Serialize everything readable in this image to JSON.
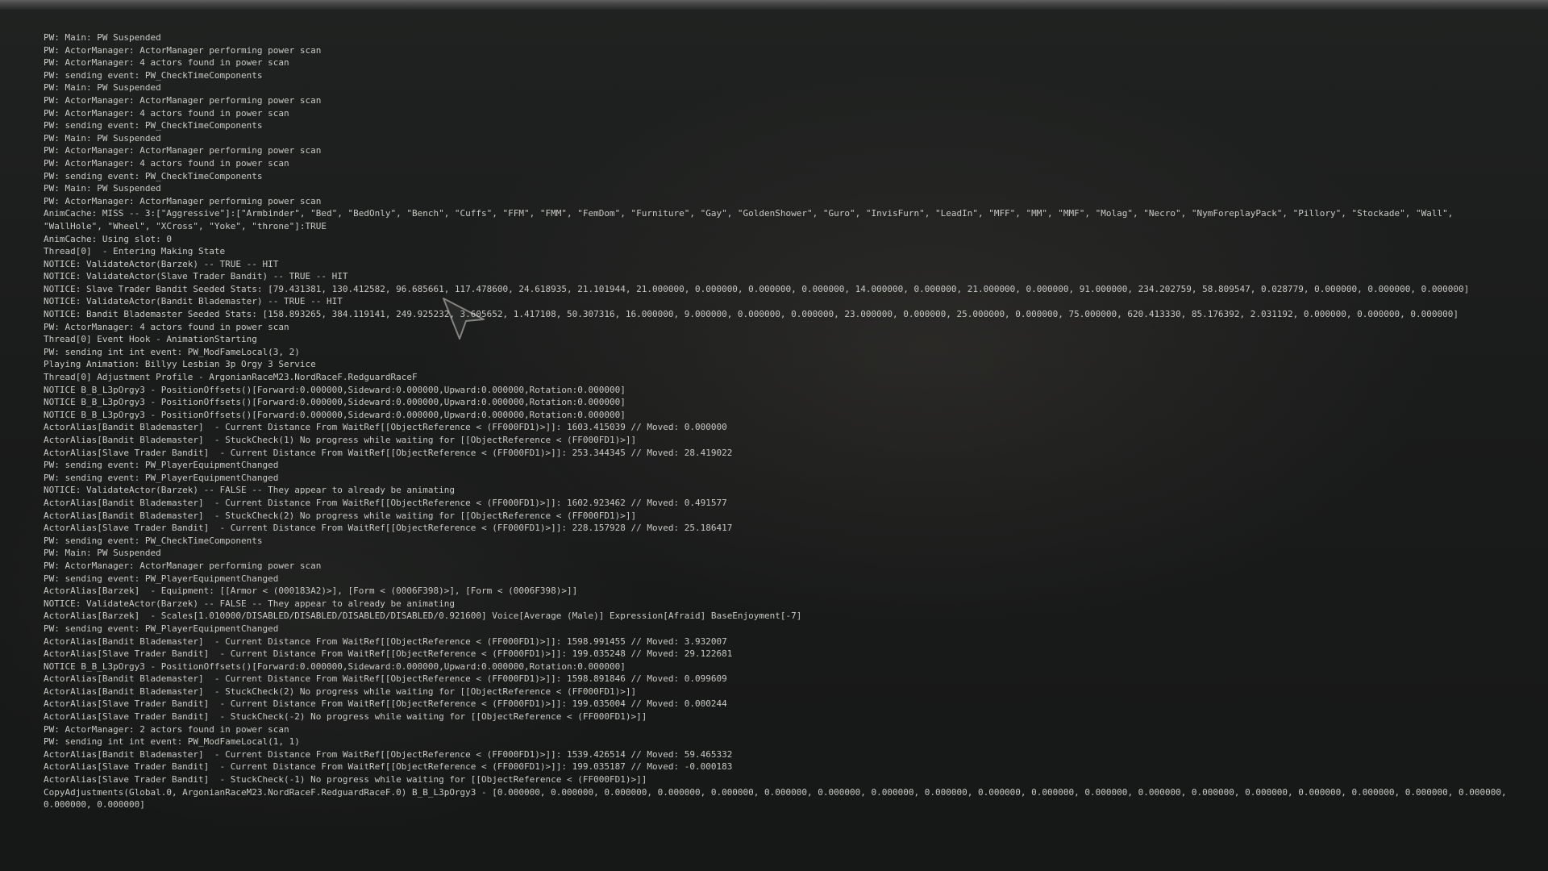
{
  "console": {
    "lines": [
      "PW: Main: PW Suspended",
      "PW: ActorManager: ActorManager performing power scan",
      "PW: ActorManager: 4 actors found in power scan",
      "PW: sending event: PW_CheckTimeComponents",
      "PW: Main: PW Suspended",
      "PW: ActorManager: ActorManager performing power scan",
      "PW: ActorManager: 4 actors found in power scan",
      "PW: sending event: PW_CheckTimeComponents",
      "PW: Main: PW Suspended",
      "PW: ActorManager: ActorManager performing power scan",
      "PW: ActorManager: 4 actors found in power scan",
      "PW: sending event: PW_CheckTimeComponents",
      "PW: Main: PW Suspended",
      "PW: ActorManager: ActorManager performing power scan",
      "AnimCache: MISS -- 3:[\"Aggressive\"]:[\"Armbinder\", \"Bed\", \"BedOnly\", \"Bench\", \"Cuffs\", \"FFM\", \"FMM\", \"FemDom\", \"Furniture\", \"Gay\", \"GoldenShower\", \"Guro\", \"InvisFurn\", \"LeadIn\", \"MFF\", \"MM\", \"MMF\", \"Molag\", \"Necro\", \"NymForeplayPack\", \"Pillory\", \"Stockade\", \"Wall\", \"WallHole\", \"Wheel\", \"XCross\", \"Yoke\", \"throne\"]:TRUE",
      "AnimCache: Using slot: 0",
      "Thread[0]  - Entering Making State",
      "NOTICE: ValidateActor(Barzek) -- TRUE -- HIT",
      "NOTICE: ValidateActor(Slave Trader Bandit) -- TRUE -- HIT",
      "NOTICE: Slave Trader Bandit Seeded Stats: [79.431381, 130.412582, 96.685661, 117.478600, 24.618935, 21.101944, 21.000000, 0.000000, 0.000000, 0.000000, 14.000000, 0.000000, 21.000000, 0.000000, 91.000000, 234.202759, 58.809547, 0.028779, 0.000000, 0.000000, 0.000000]",
      "NOTICE: ValidateActor(Bandit Blademaster) -- TRUE -- HIT",
      "NOTICE: Bandit Blademaster Seeded Stats: [158.893265, 384.119141, 249.925232, 3.605652, 1.417108, 50.307316, 16.000000, 9.000000, 0.000000, 0.000000, 23.000000, 0.000000, 25.000000, 0.000000, 75.000000, 620.413330, 85.176392, 2.031192, 0.000000, 0.000000, 0.000000]",
      "PW: ActorManager: 4 actors found in power scan",
      "Thread[0] Event Hook - AnimationStarting",
      "PW: sending int int event: PW_ModFameLocal(3, 2)",
      "Playing Animation: Billyy Lesbian 3p Orgy 3 Service",
      "Thread[0] Adjustment Profile - ArgonianRaceM23.NordRaceF.RedguardRaceF",
      "NOTICE B_B_L3pOrgy3 - PositionOffsets()[Forward:0.000000,Sideward:0.000000,Upward:0.000000,Rotation:0.000000]",
      "NOTICE B_B_L3pOrgy3 - PositionOffsets()[Forward:0.000000,Sideward:0.000000,Upward:0.000000,Rotation:0.000000]",
      "NOTICE B_B_L3pOrgy3 - PositionOffsets()[Forward:0.000000,Sideward:0.000000,Upward:0.000000,Rotation:0.000000]",
      "ActorAlias[Bandit Blademaster]  - Current Distance From WaitRef[[ObjectReference < (FF000FD1)>]]: 1603.415039 // Moved: 0.000000",
      "ActorAlias[Bandit Blademaster]  - StuckCheck(1) No progress while waiting for [[ObjectReference < (FF000FD1)>]]",
      "ActorAlias[Slave Trader Bandit]  - Current Distance From WaitRef[[ObjectReference < (FF000FD1)>]]: 253.344345 // Moved: 28.419022",
      "PW: sending event: PW_PlayerEquipmentChanged",
      "PW: sending event: PW_PlayerEquipmentChanged",
      "NOTICE: ValidateActor(Barzek) -- FALSE -- They appear to already be animating",
      "ActorAlias[Bandit Blademaster]  - Current Distance From WaitRef[[ObjectReference < (FF000FD1)>]]: 1602.923462 // Moved: 0.491577",
      "ActorAlias[Bandit Blademaster]  - StuckCheck(2) No progress while waiting for [[ObjectReference < (FF000FD1)>]]",
      "ActorAlias[Slave Trader Bandit]  - Current Distance From WaitRef[[ObjectReference < (FF000FD1)>]]: 228.157928 // Moved: 25.186417",
      "PW: sending event: PW_CheckTimeComponents",
      "PW: Main: PW Suspended",
      "PW: ActorManager: ActorManager performing power scan",
      "PW: sending event: PW_PlayerEquipmentChanged",
      "ActorAlias[Barzek]  - Equipment: [[Armor < (000183A2)>], [Form < (0006F398)>], [Form < (0006F398)>]]",
      "NOTICE: ValidateActor(Barzek) -- FALSE -- They appear to already be animating",
      "ActorAlias[Barzek]  - Scales[1.010000/DISABLED/DISABLED/DISABLED/DISABLED/0.921600] Voice[Average (Male)] Expression[Afraid] BaseEnjoyment[-7]",
      "PW: sending event: PW_PlayerEquipmentChanged",
      "ActorAlias[Bandit Blademaster]  - Current Distance From WaitRef[[ObjectReference < (FF000FD1)>]]: 1598.991455 // Moved: 3.932007",
      "ActorAlias[Slave Trader Bandit]  - Current Distance From WaitRef[[ObjectReference < (FF000FD1)>]]: 199.035248 // Moved: 29.122681",
      "NOTICE B_B_L3pOrgy3 - PositionOffsets()[Forward:0.000000,Sideward:0.000000,Upward:0.000000,Rotation:0.000000]",
      "ActorAlias[Bandit Blademaster]  - Current Distance From WaitRef[[ObjectReference < (FF000FD1)>]]: 1598.891846 // Moved: 0.099609",
      "ActorAlias[Bandit Blademaster]  - StuckCheck(2) No progress while waiting for [[ObjectReference < (FF000FD1)>]]",
      "ActorAlias[Slave Trader Bandit]  - Current Distance From WaitRef[[ObjectReference < (FF000FD1)>]]: 199.035004 // Moved: 0.000244",
      "ActorAlias[Slave Trader Bandit]  - StuckCheck(-2) No progress while waiting for [[ObjectReference < (FF000FD1)>]]",
      "PW: ActorManager: 2 actors found in power scan",
      "PW: sending int int event: PW_ModFameLocal(1, 1)",
      "ActorAlias[Bandit Blademaster]  - Current Distance From WaitRef[[ObjectReference < (FF000FD1)>]]: 1539.426514 // Moved: 59.465332",
      "ActorAlias[Slave Trader Bandit]  - Current Distance From WaitRef[[ObjectReference < (FF000FD1)>]]: 199.035187 // Moved: -0.000183",
      "ActorAlias[Slave Trader Bandit]  - StuckCheck(-1) No progress while waiting for [[ObjectReference < (FF000FD1)>]]",
      "CopyAdjustments(Global.0, ArgonianRaceM23.NordRaceF.RedguardRaceF.0) B_B_L3pOrgy3 - [0.000000, 0.000000, 0.000000, 0.000000, 0.000000, 0.000000, 0.000000, 0.000000, 0.000000, 0.000000, 0.000000, 0.000000, 0.000000, 0.000000, 0.000000, 0.000000, 0.000000, 0.000000, 0.000000, 0.000000, 0.000000]"
    ]
  },
  "cursor_icon": "mouse-pointer-icon",
  "colors": {
    "text": "#c9c9c4",
    "background": "#1b1c1c"
  }
}
